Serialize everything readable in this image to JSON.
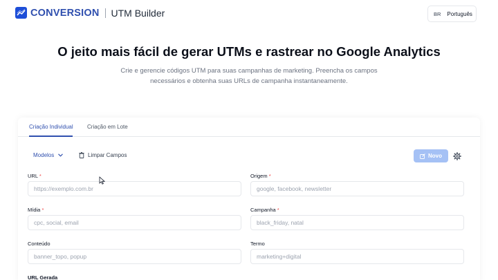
{
  "header": {
    "brand_name": "CONVERSION",
    "brand_sub": "UTM Builder",
    "lang_code": "BR",
    "lang_label": "Português"
  },
  "hero": {
    "title": "O jeito mais fácil de gerar UTMs e rastrear no Google Analytics",
    "description": "Crie e gerencie códigos UTM para suas campanhas de marketing. Preencha os campos necessários e obtenha suas URLs de campanha instantaneamente."
  },
  "tabs": [
    {
      "label": "Criação Individual",
      "active": true
    },
    {
      "label": "Criação em Lote",
      "active": false
    }
  ],
  "toolbar": {
    "models_label": "Modelos",
    "clear_label": "Limpar Campos",
    "new_label": "Novo"
  },
  "fields": {
    "url": {
      "label": "URL",
      "required": "*",
      "placeholder": "https://exemplo.com.br"
    },
    "origem": {
      "label": "Origem",
      "required": "*",
      "placeholder": "google, facebook, newsletter"
    },
    "midia": {
      "label": "Mídia",
      "required": "*",
      "placeholder": "cpc, social, email"
    },
    "campanha": {
      "label": "Campanha",
      "required": "*",
      "placeholder": "black_friday, natal"
    },
    "conteudo": {
      "label": "Conteúdo",
      "placeholder": "banner_topo, popup"
    },
    "termo": {
      "label": "Termo",
      "placeholder": "marketing+digital"
    },
    "gerada": {
      "label": "URL Gerada"
    }
  },
  "colors": {
    "accent": "#2f4fae",
    "button_disabled": "#a5c1f5",
    "required": "#ef4444"
  },
  "icons": [
    "chart-line-icon",
    "chevron-down-icon",
    "trash-icon",
    "edit-icon",
    "gear-icon",
    "cursor-icon"
  ]
}
